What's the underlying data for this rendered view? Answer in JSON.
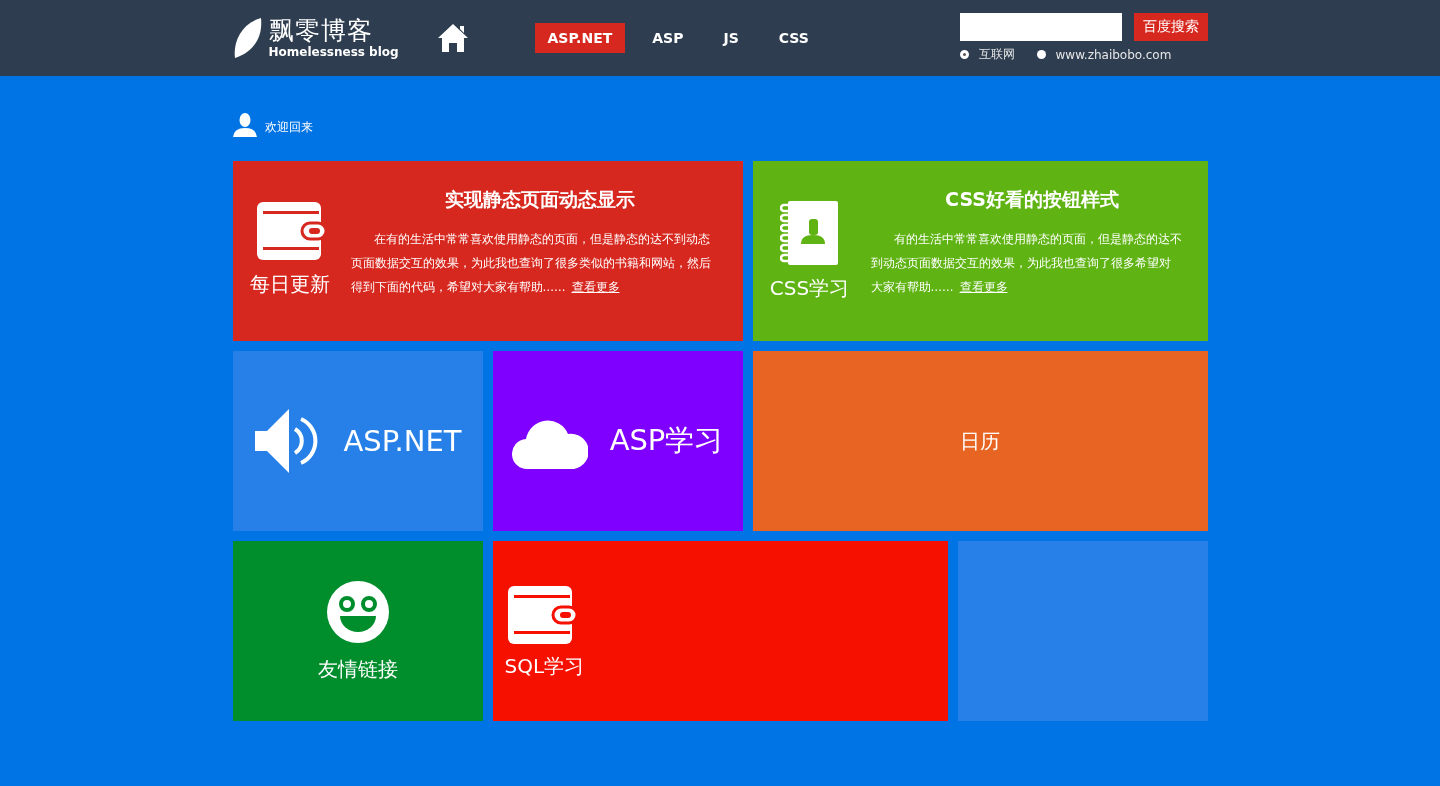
{
  "header": {
    "logo_title": "飘零博客",
    "logo_subtitle": "Homelessness blog",
    "nav": [
      {
        "label": "ASP.NET",
        "selected": true
      },
      {
        "label": "ASP",
        "selected": false
      },
      {
        "label": "JS",
        "selected": false
      },
      {
        "label": "CSS",
        "selected": false
      }
    ],
    "search": {
      "button": "百度搜索",
      "options": [
        {
          "label": "互联网",
          "selected": true
        },
        {
          "label": "www.zhaibobo.com",
          "selected": false
        }
      ]
    }
  },
  "welcome": "欢迎回来",
  "tiles": [
    [
      {
        "kind": "article",
        "label": "每日更新",
        "title": "实现静态页面动态显示",
        "text": "在有的生活中常常喜欢使用静态的页面，但是静态的达不到动态页面数据交互的效果，为此我也查询了很多类似的书籍和网站，然后得到下面的代码，希望对大家有帮助……",
        "link": "查看更多",
        "color": "#d7281f"
      },
      {
        "kind": "article",
        "label": "CSS学习",
        "title": "CSS好看的按钮样式",
        "text": "有的生活中常常喜欢使用静态的页面，但是静态的达不到动态页面数据交互的效果，为此我也查询了很多希望对大家有帮助……",
        "link": "查看更多",
        "color": "#5fb312"
      }
    ],
    [
      {
        "kind": "row",
        "label": "ASP.NET",
        "color": "#2680e8"
      },
      {
        "kind": "row",
        "label": "ASP学习",
        "color": "#8000ff"
      },
      {
        "kind": "text",
        "label": "日历",
        "color": "#e86422"
      }
    ],
    [
      {
        "kind": "stack",
        "label": "友情链接",
        "color": "#008e2c"
      },
      {
        "kind": "corner",
        "label": "SQL学习",
        "color": "#f51000"
      },
      {
        "kind": "blank",
        "color": "#2680e8"
      }
    ]
  ]
}
